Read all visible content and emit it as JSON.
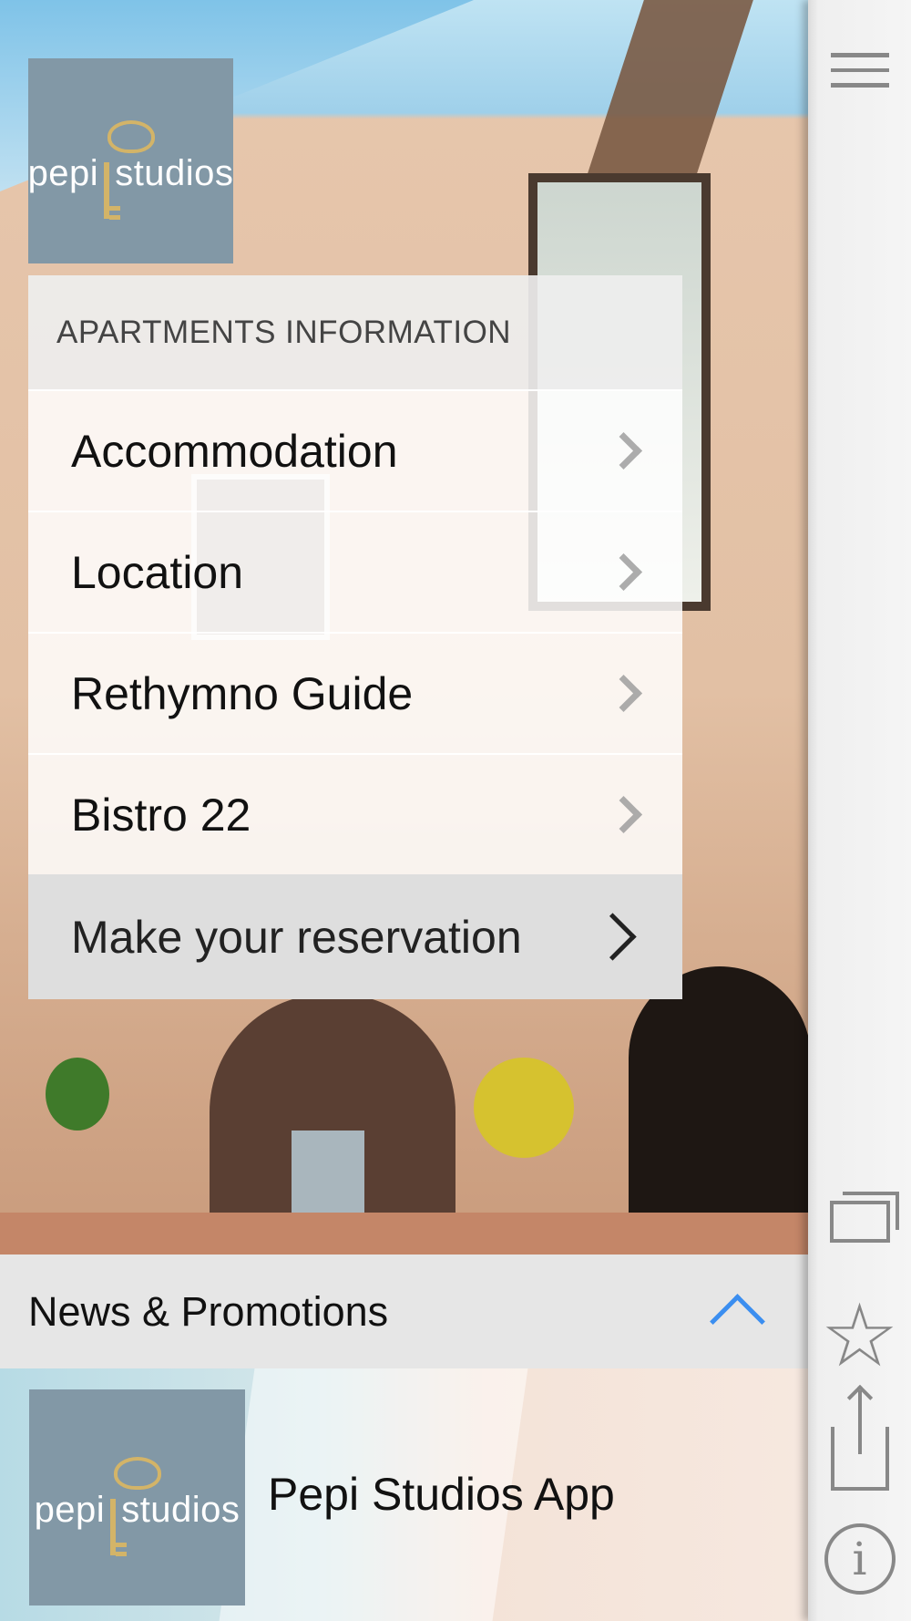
{
  "brand": {
    "logo_text_left": "pepi",
    "logo_text_right": "studios"
  },
  "menu": {
    "header": "APARTMENTS INFORMATION",
    "items": [
      {
        "label": "Accommodation"
      },
      {
        "label": "Location"
      },
      {
        "label": "Rethymno Guide"
      },
      {
        "label": "Bistro 22"
      }
    ],
    "cta_label": "Make your reservation"
  },
  "news": {
    "title": "News & Promotions",
    "item_title": "Pepi Studios App"
  },
  "toolbar": {
    "icons": [
      "hamburger-menu-icon",
      "gallery-icon",
      "star-icon",
      "share-icon",
      "info-icon"
    ]
  },
  "colors": {
    "logo_bg": "#8298a6",
    "logo_accent": "#d3b468",
    "accent": "#3b8ef0"
  }
}
